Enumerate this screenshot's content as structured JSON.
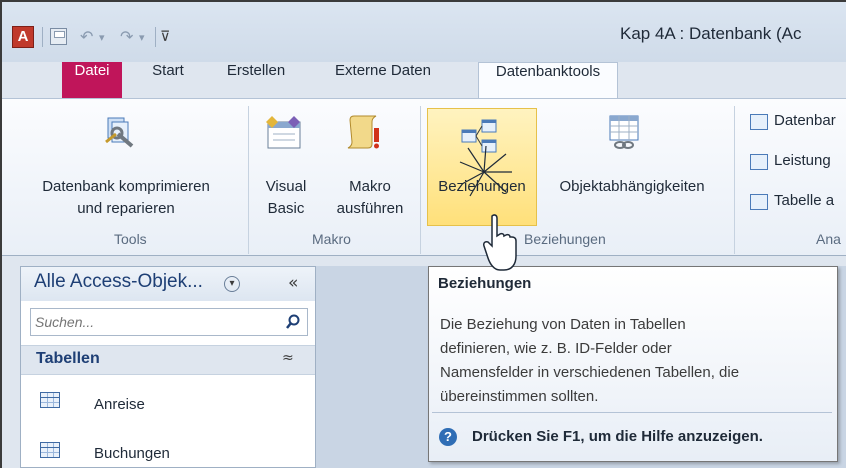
{
  "window": {
    "title": "Kap 4A : Datenbank (Ac"
  },
  "quick_access": {
    "app_icon_letter": "A",
    "undo_glyph": "↶",
    "redo_glyph": "↷",
    "customize_glyph": "⊽"
  },
  "tabs": [
    {
      "label": "Datei"
    },
    {
      "label": "Start"
    },
    {
      "label": "Erstellen"
    },
    {
      "label": "Externe Daten"
    },
    {
      "label": "Datenbanktools"
    }
  ],
  "ribbon": {
    "groups": {
      "tools": {
        "label": "Tools",
        "compact_line1": "Datenbank komprimieren",
        "compact_line2": "und reparieren"
      },
      "makro": {
        "label": "Makro",
        "vb_line1": "Visual",
        "vb_line2": "Basic",
        "run_line1": "Makro",
        "run_line2": "ausführen"
      },
      "beziehungen": {
        "label": "Beziehungen",
        "rel_label": "Beziehungen",
        "dep_label": "Objektabhängigkeiten"
      },
      "analyze": {
        "label": "Ana",
        "item1": "Datenbar",
        "item2": "Leistung",
        "item3": "Tabelle a"
      }
    }
  },
  "nav": {
    "title": "Alle Access-Objek...",
    "collapse_glyph": "«",
    "search_placeholder": "Suchen...",
    "group_title": "Tabellen",
    "group_collapse_glyph": "≈",
    "items": [
      {
        "label": "Anreise"
      },
      {
        "label": "Buchungen"
      }
    ]
  },
  "tooltip": {
    "title": "Beziehungen",
    "lines": [
      "Die Beziehung von Daten in Tabellen",
      "definieren, wie z. B. ID-Felder oder",
      "Namensfelder in verschiedenen Tabellen, die",
      "übereinstimmen sollten."
    ],
    "help_text": "Drücken Sie F1, um die Hilfe anzuzeigen.",
    "help_icon_glyph": "?"
  },
  "colors": {
    "datei_tab": "#c0155a",
    "highlight": "#ffe07a",
    "nav_title": "#1e3f75"
  }
}
